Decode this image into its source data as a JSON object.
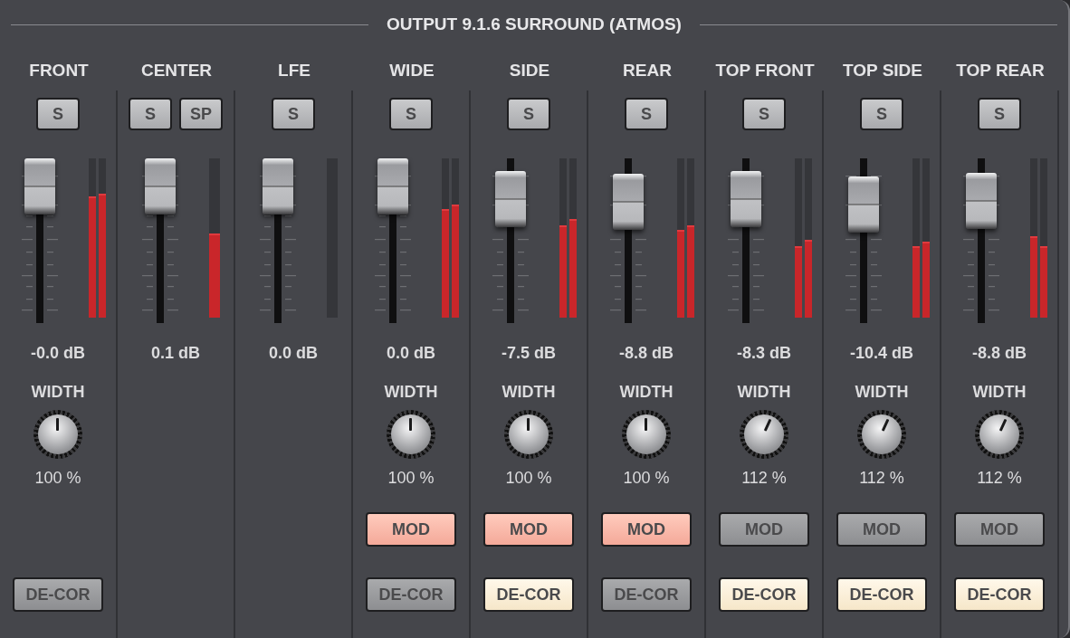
{
  "title": "OUTPUT 9.1.6 SURROUND (ATMOS)",
  "channels": [
    {
      "name": "FRONT",
      "solo": [
        {
          "label": "S",
          "on": false
        }
      ],
      "fader": {
        "level": 1.0
      },
      "meters": [
        {
          "level": 0.76
        },
        {
          "level": 0.78
        }
      ],
      "db": "-0.0 dB",
      "width": {
        "label": "WIDTH",
        "level": 0.5,
        "value": "100 %"
      },
      "decor": {
        "label": "DE-COR",
        "on": false
      }
    },
    {
      "name": "CENTER",
      "solo": [
        {
          "label": "S",
          "on": false
        },
        {
          "label": "SP",
          "on": false
        }
      ],
      "fader": {
        "level": 1.0
      },
      "meters": [
        {
          "kind": "mono",
          "level": 0.53
        }
      ],
      "db": "0.1 dB"
    },
    {
      "name": "LFE",
      "solo": [
        {
          "label": "S",
          "on": false
        }
      ],
      "fader": {
        "level": 1.0
      },
      "meters": [
        {
          "kind": "mono"
        }
      ],
      "db": "0.0 dB"
    },
    {
      "name": "WIDE",
      "solo": [
        {
          "label": "S",
          "on": false
        }
      ],
      "fader": {
        "level": 1.0
      },
      "meters": [
        {
          "level": 0.68
        },
        {
          "level": 0.71
        }
      ],
      "db": "0.0 dB",
      "width": {
        "label": "WIDTH",
        "level": 0.5,
        "value": "100 %"
      },
      "mod": {
        "label": "MOD",
        "on": true
      },
      "decor": {
        "label": "DE-COR",
        "on": false
      }
    },
    {
      "name": "SIDE",
      "solo": [
        {
          "label": "S",
          "on": false
        }
      ],
      "fader": {
        "level": 0.88
      },
      "meters": [
        {
          "level": 0.58
        },
        {
          "level": 0.62
        }
      ],
      "db": "-7.5 dB",
      "width": {
        "label": "WIDTH",
        "level": 0.5,
        "value": "100 %"
      },
      "mod": {
        "label": "MOD",
        "on": true
      },
      "decor": {
        "label": "DE-COR",
        "on": true
      }
    },
    {
      "name": "REAR",
      "solo": [
        {
          "label": "S",
          "on": false
        }
      ],
      "fader": {
        "level": 0.86
      },
      "meters": [
        {
          "level": 0.55
        },
        {
          "level": 0.58
        }
      ],
      "db": "-8.8 dB",
      "width": {
        "label": "WIDTH",
        "level": 0.5,
        "value": "100 %"
      },
      "mod": {
        "label": "MOD",
        "on": true
      },
      "decor": {
        "label": "DE-COR",
        "on": false
      }
    },
    {
      "name": "TOP FRONT",
      "solo": [
        {
          "label": "S",
          "on": false
        }
      ],
      "fader": {
        "level": 0.88
      },
      "meters": [
        {
          "level": 0.45
        },
        {
          "level": 0.49
        }
      ],
      "db": "-8.3 dB",
      "width": {
        "label": "WIDTH",
        "level": 0.59,
        "value": "112 %"
      },
      "mod": {
        "label": "MOD",
        "on": false
      },
      "decor": {
        "label": "DE-COR",
        "on": true
      }
    },
    {
      "name": "TOP SIDE",
      "solo": [
        {
          "label": "S",
          "on": false
        }
      ],
      "fader": {
        "level": 0.83
      },
      "meters": [
        {
          "level": 0.45
        },
        {
          "level": 0.48
        }
      ],
      "db": "-10.4 dB",
      "width": {
        "label": "WIDTH",
        "level": 0.59,
        "value": "112 %"
      },
      "mod": {
        "label": "MOD",
        "on": false
      },
      "decor": {
        "label": "DE-COR",
        "on": true
      }
    },
    {
      "name": "TOP REAR",
      "solo": [
        {
          "label": "S",
          "on": false
        }
      ],
      "fader": {
        "level": 0.87
      },
      "meters": [
        {
          "level": 0.51
        },
        {
          "level": 0.45
        }
      ],
      "db": "-8.8 dB",
      "width": {
        "label": "WIDTH",
        "level": 0.59,
        "value": "112 %"
      },
      "mod": {
        "label": "MOD",
        "on": false
      },
      "decor": {
        "label": "DE-COR",
        "on": true
      }
    }
  ]
}
